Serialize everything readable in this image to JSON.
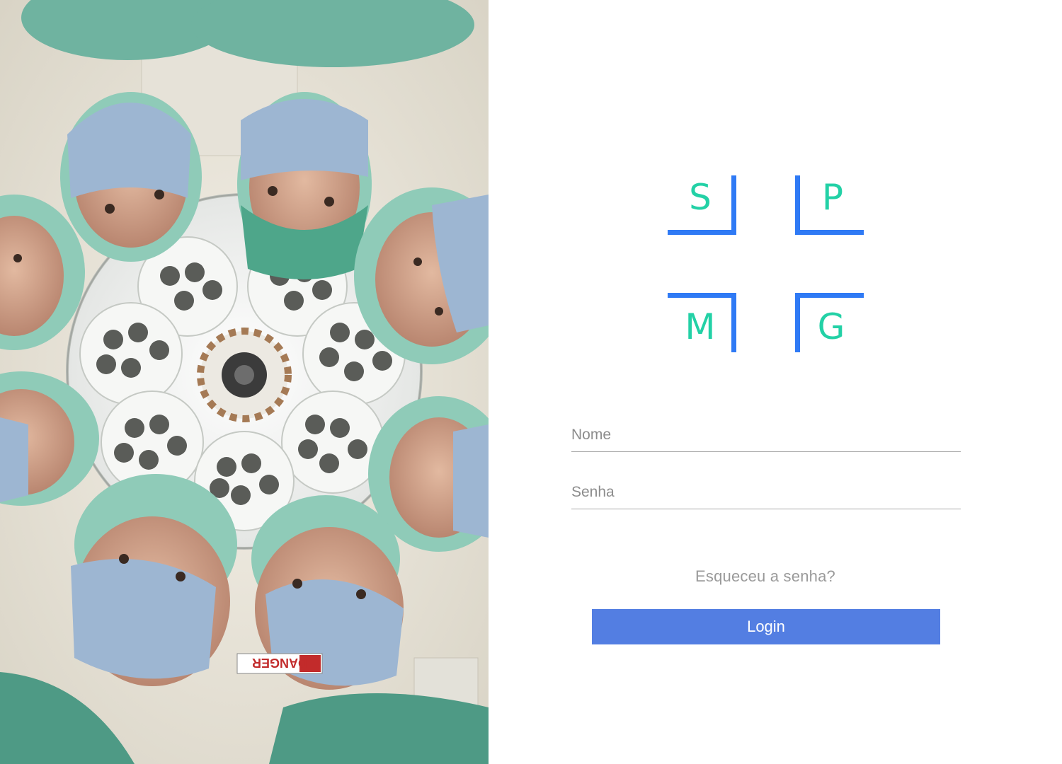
{
  "hero": {
    "warning_sign_text": "DANGER"
  },
  "logo": {
    "letters": [
      "S",
      "P",
      "M",
      "G"
    ],
    "bracket_color": "#2f7af5",
    "letter_color": "#23d1a6"
  },
  "form": {
    "name_placeholder": "Nome",
    "password_placeholder": "Senha",
    "forgot_password_label": "Esqueceu a senha?",
    "login_label": "Login"
  },
  "colors": {
    "button": "#537ee2",
    "underline": "#a8a8a8",
    "placeholder": "#8c8c8c"
  }
}
